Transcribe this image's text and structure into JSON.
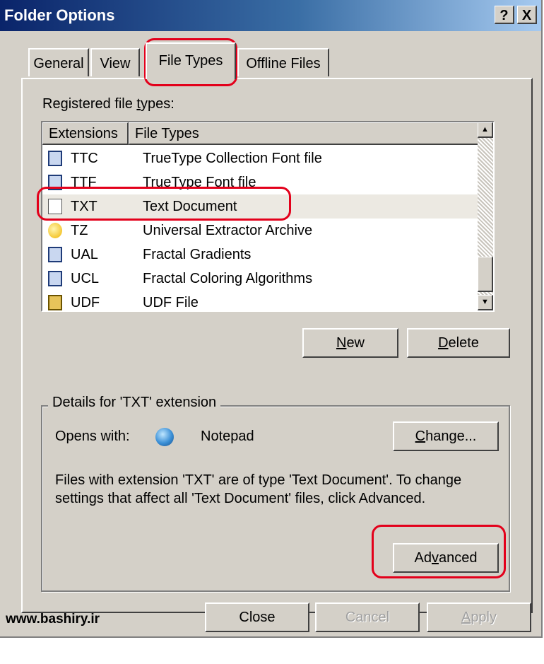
{
  "window": {
    "title": "Folder Options",
    "help_button": "?",
    "close_button": "X"
  },
  "tabs": [
    {
      "label": "General"
    },
    {
      "label": "View"
    },
    {
      "label": "File Types"
    },
    {
      "label": "Offline Files"
    }
  ],
  "registered_label_pre": "Registered file ",
  "registered_label_u": "t",
  "registered_label_post": "ypes:",
  "list": {
    "columns": [
      "Extensions",
      "File Types"
    ],
    "rows": [
      {
        "ext": "TTC",
        "type": "TrueType Collection Font file",
        "icon": "font-file-icon"
      },
      {
        "ext": "TTF",
        "type": "TrueType Font file",
        "icon": "font-file-icon"
      },
      {
        "ext": "TXT",
        "type": "Text Document",
        "icon": "text-document-icon"
      },
      {
        "ext": "TZ",
        "type": "Universal Extractor Archive",
        "icon": "archive-icon"
      },
      {
        "ext": "UAL",
        "type": "Fractal Gradients",
        "icon": "document-icon"
      },
      {
        "ext": "UCL",
        "type": "Fractal Coloring Algorithms",
        "icon": "document-icon"
      },
      {
        "ext": "UDF",
        "type": "UDF File",
        "icon": "udf-file-icon"
      }
    ]
  },
  "buttons": {
    "new_u": "N",
    "new_rest": "ew",
    "delete_u": "D",
    "delete_rest": "elete",
    "change_u": "C",
    "change_rest": "hange...",
    "advanced_pre": "Ad",
    "advanced_u": "v",
    "advanced_post": "anced",
    "close": "Close",
    "cancel": "Cancel",
    "apply_u": "A",
    "apply_rest": "pply"
  },
  "details": {
    "legend": "Details for 'TXT' extension",
    "opens_with_label": "Opens with:",
    "opens_with_app": "Notepad",
    "desc_line1": "Files with extension 'TXT' are of type 'Text Document'.  To change",
    "desc_line2": "settings that affect all 'Text Document' files, click Advanced."
  },
  "watermark": "www.bashiry.ir",
  "colors": {
    "annotation": "#e3001b",
    "title_bar": "#0a246a"
  }
}
